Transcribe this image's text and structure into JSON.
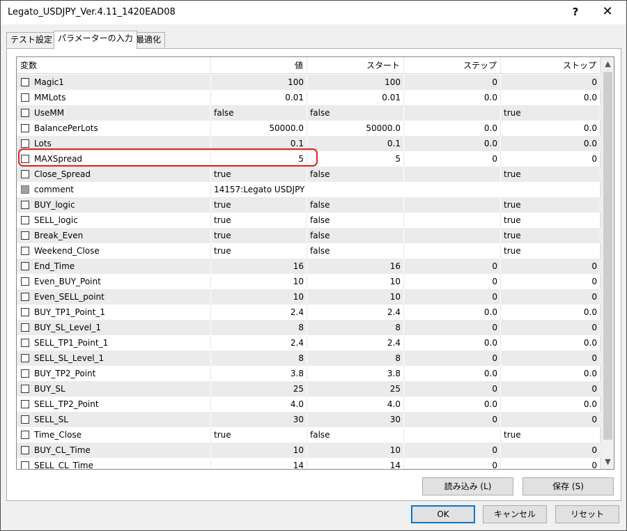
{
  "window": {
    "title": "Legato_USDJPY_Ver.4.11_1420EAD08",
    "help_glyph": "?",
    "close_glyph": "✕"
  },
  "tabs": [
    {
      "label": "テスト設定"
    },
    {
      "label": "パラメーターの入力",
      "active": true
    },
    {
      "label": "最適化"
    }
  ],
  "columns": {
    "variable": "変数",
    "value": "値",
    "start": "スタート",
    "step": "ステップ",
    "stop": "ストップ"
  },
  "rows": [
    {
      "name": "Magic1",
      "value": "100",
      "start": "100",
      "step": "0",
      "stop": "0",
      "align": "r"
    },
    {
      "name": "MMLots",
      "value": "0.01",
      "start": "0.01",
      "step": "0.0",
      "stop": "0.0",
      "align": "r"
    },
    {
      "name": "UseMM",
      "value": "false",
      "start": "false",
      "step": "",
      "stop": "true",
      "align": "l"
    },
    {
      "name": "BalancePerLots",
      "value": "50000.0",
      "start": "50000.0",
      "step": "0.0",
      "stop": "0.0",
      "align": "r"
    },
    {
      "name": "Lots",
      "value": "0.1",
      "start": "0.1",
      "step": "0.0",
      "stop": "0.0",
      "align": "r"
    },
    {
      "name": "MAXSpread",
      "value": "5",
      "start": "5",
      "step": "0",
      "stop": "0",
      "align": "r"
    },
    {
      "name": "Close_Spread",
      "value": "true",
      "start": "false",
      "step": "",
      "stop": "true",
      "align": "l"
    },
    {
      "name": "comment",
      "value": "14157:Legato USDJPY",
      "start": "",
      "step": "",
      "stop": "",
      "align": "l",
      "disabled": true
    },
    {
      "name": "BUY_logic",
      "value": "true",
      "start": "false",
      "step": "",
      "stop": "true",
      "align": "l"
    },
    {
      "name": "SELL_logic",
      "value": "true",
      "start": "false",
      "step": "",
      "stop": "true",
      "align": "l"
    },
    {
      "name": "Break_Even",
      "value": "true",
      "start": "false",
      "step": "",
      "stop": "true",
      "align": "l"
    },
    {
      "name": "Weekend_Close",
      "value": "true",
      "start": "false",
      "step": "",
      "stop": "true",
      "align": "l"
    },
    {
      "name": "End_Time",
      "value": "16",
      "start": "16",
      "step": "0",
      "stop": "0",
      "align": "r"
    },
    {
      "name": "Even_BUY_Point",
      "value": "10",
      "start": "10",
      "step": "0",
      "stop": "0",
      "align": "r"
    },
    {
      "name": "Even_SELL_point",
      "value": "10",
      "start": "10",
      "step": "0",
      "stop": "0",
      "align": "r"
    },
    {
      "name": "BUY_TP1_Point_1",
      "value": "2.4",
      "start": "2.4",
      "step": "0.0",
      "stop": "0.0",
      "align": "r"
    },
    {
      "name": "BUY_SL_Level_1",
      "value": "8",
      "start": "8",
      "step": "0",
      "stop": "0",
      "align": "r"
    },
    {
      "name": "SELL_TP1_Point_1",
      "value": "2.4",
      "start": "2.4",
      "step": "0.0",
      "stop": "0.0",
      "align": "r"
    },
    {
      "name": "SELL_SL_Level_1",
      "value": "8",
      "start": "8",
      "step": "0",
      "stop": "0",
      "align": "r"
    },
    {
      "name": "BUY_TP2_Point",
      "value": "3.8",
      "start": "3.8",
      "step": "0.0",
      "stop": "0.0",
      "align": "r"
    },
    {
      "name": "BUY_SL",
      "value": "25",
      "start": "25",
      "step": "0",
      "stop": "0",
      "align": "r"
    },
    {
      "name": "SELL_TP2_Point",
      "value": "4.0",
      "start": "4.0",
      "step": "0.0",
      "stop": "0.0",
      "align": "r"
    },
    {
      "name": "SELL_SL",
      "value": "30",
      "start": "30",
      "step": "0",
      "stop": "0",
      "align": "r"
    },
    {
      "name": "Time_Close",
      "value": "true",
      "start": "false",
      "step": "",
      "stop": "true",
      "align": "l"
    },
    {
      "name": "BUY_CL_Time",
      "value": "10",
      "start": "10",
      "step": "0",
      "stop": "0",
      "align": "r"
    },
    {
      "name": "SELL_CL_Time",
      "value": "14",
      "start": "14",
      "step": "0",
      "stop": "0",
      "align": "r"
    }
  ],
  "scrollbar": {
    "up_glyph": "▲",
    "down_glyph": "▼"
  },
  "buttons": {
    "load": "読み込み (L)",
    "save": "保存 (S)",
    "ok": "OK",
    "cancel": "キャンセル",
    "reset": "リセット"
  },
  "colors": {
    "highlight": "#e02020",
    "default_button_border": "#0078d7"
  }
}
